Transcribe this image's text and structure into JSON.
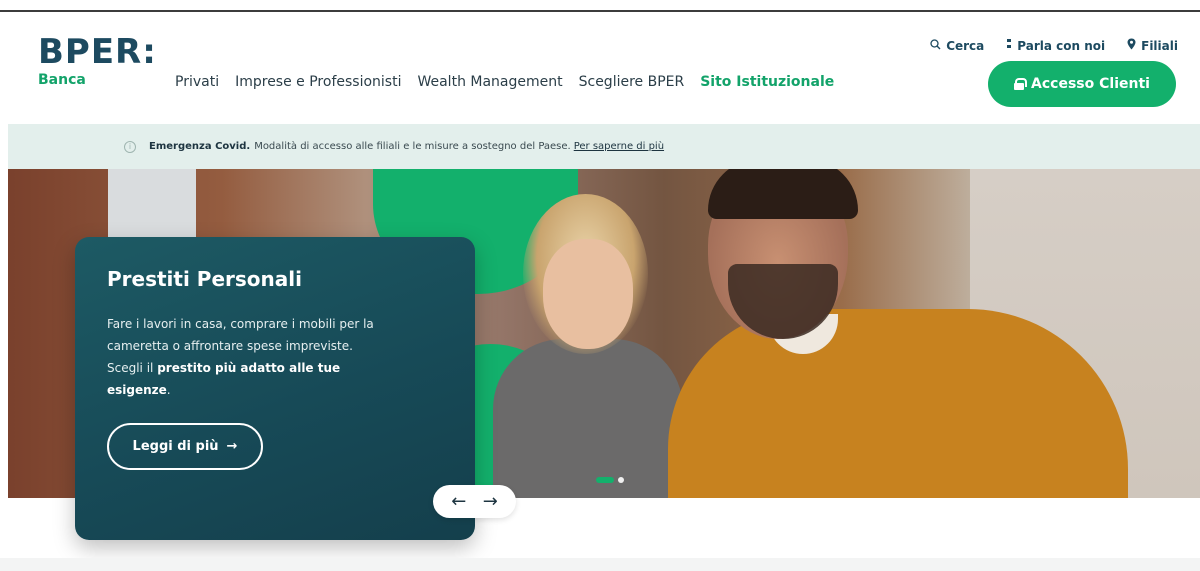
{
  "logo": {
    "mark": "BPER:",
    "sub": "Banca"
  },
  "nav": {
    "items": [
      {
        "label": "Privati"
      },
      {
        "label": "Imprese e Professionisti"
      },
      {
        "label": "Wealth Management"
      },
      {
        "label": "Scegliere BPER"
      },
      {
        "label": "Sito Istituzionale"
      }
    ]
  },
  "utility": {
    "search": {
      "label": "Cerca",
      "icon": "search-icon"
    },
    "contact": {
      "label": "Parla con noi",
      "icon": "chat-icon"
    },
    "branches": {
      "label": "Filiali",
      "icon": "location-pin-icon"
    }
  },
  "access_button": {
    "label": "Accesso Clienti",
    "icon": "lock-icon"
  },
  "banner": {
    "bold": "Emergenza Covid.",
    "text": "Modalità di accesso alle filiali e le misure a sostegno del Paese.",
    "link": "Per saperne di più"
  },
  "hero": {
    "title": "Prestiti Personali",
    "text_line1": "Fare i lavori in casa, comprare i mobili per la",
    "text_line2": "cameretta o affrontare spese impreviste.",
    "text_line3_prefix": "Scegli il",
    "text_line3_bold": "prestito più adatto alle tue esigenze",
    "text_line3_suffix": ".",
    "button_label": "Leggi di più",
    "button_arrow": "→",
    "prev_arrow": "←",
    "next_arrow": "→",
    "slides_total": 2,
    "active_slide": 1
  },
  "colors": {
    "brand_green": "#13b06c",
    "brand_navy": "#1d4a60",
    "card_teal": "#174a57"
  }
}
